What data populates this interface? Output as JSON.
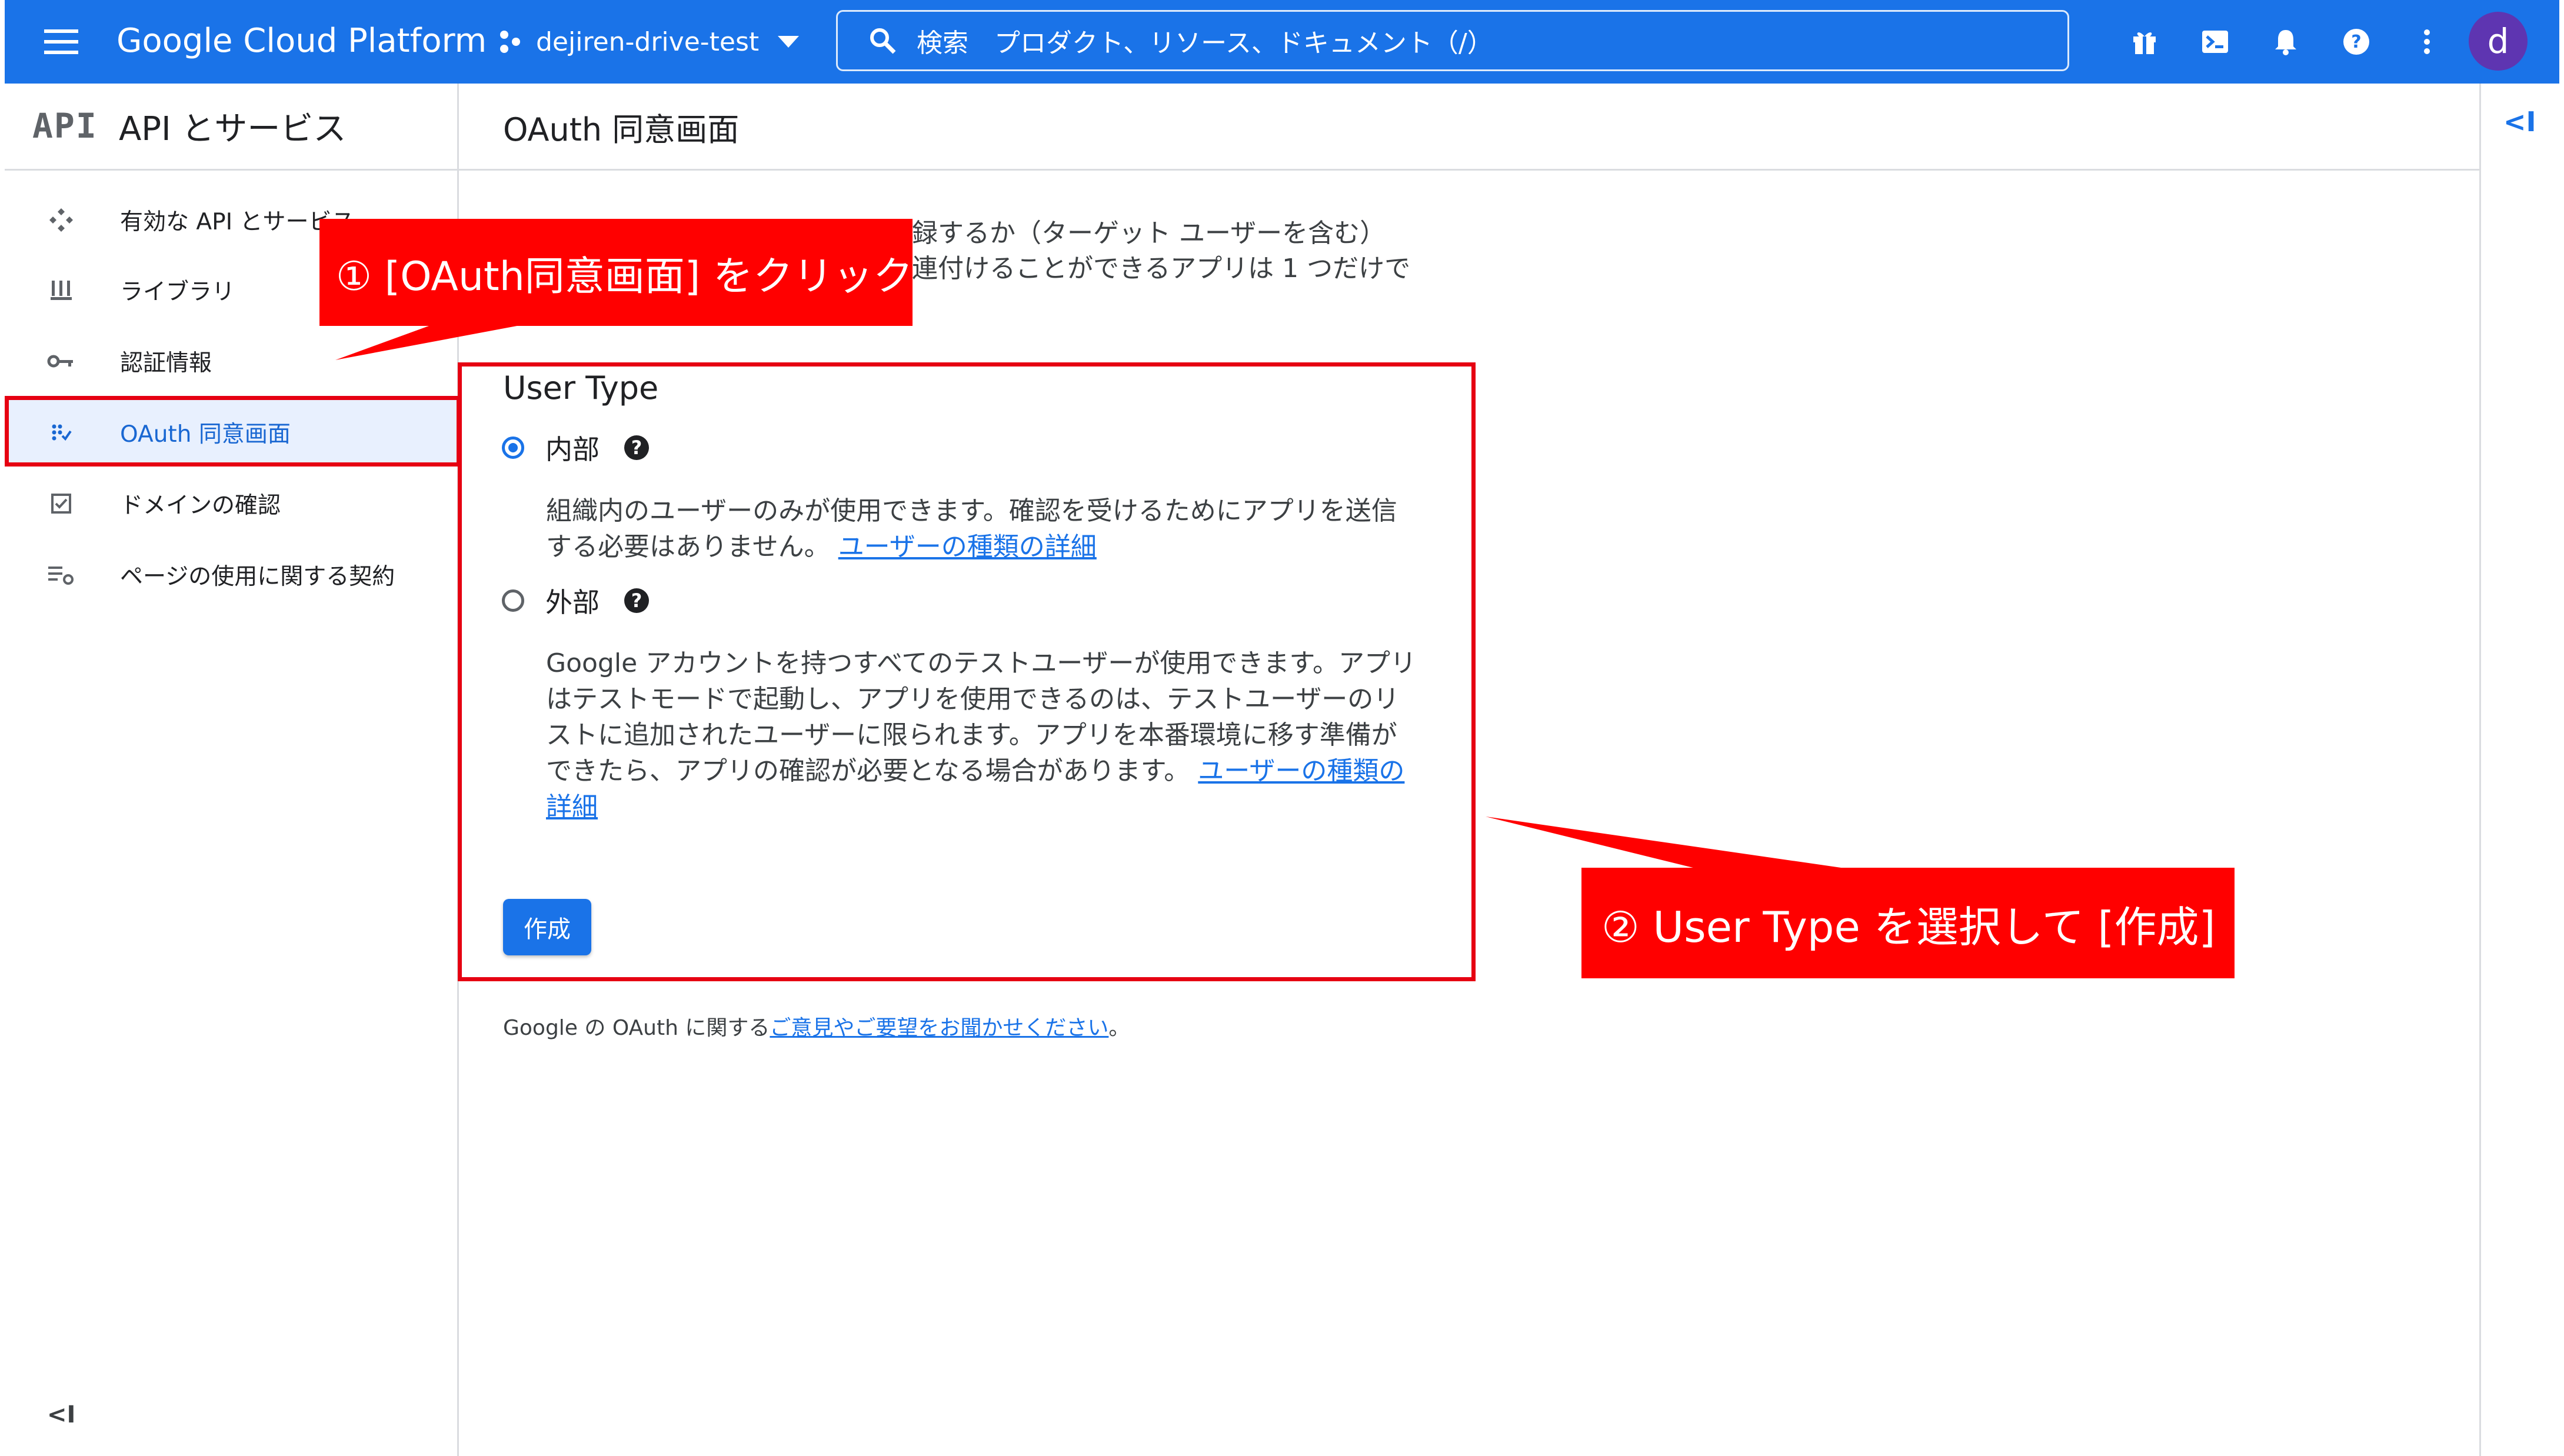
{
  "topbar": {
    "product_title": "Google Cloud Platform",
    "project_name": "dejiren-drive-test",
    "search_placeholder": "検索　プロダクト、リソース、ドキュメント（/）",
    "avatar_letter": "d",
    "icons": [
      "menu-icon",
      "gift-icon",
      "cloud-shell-icon",
      "notifications-icon",
      "help-icon",
      "more-vert-icon"
    ]
  },
  "sidebar": {
    "logo": "API",
    "title": "API とサービス",
    "items": [
      {
        "label": "有効な API とサービス",
        "icon": "api-icon"
      },
      {
        "label": "ライブラリ",
        "icon": "library-icon"
      },
      {
        "label": "認証情報",
        "icon": "key-icon"
      },
      {
        "label": "OAuth 同意画面",
        "icon": "oauth-consent-icon",
        "active": true
      },
      {
        "label": "ドメインの確認",
        "icon": "checkbox-icon"
      },
      {
        "label": "ページの使用に関する契約",
        "icon": "settings-list-icon"
      }
    ],
    "collapse_label": "<I"
  },
  "main": {
    "page_title": "OAuth 同意画面",
    "intro_line1": "録するか（ターゲット ユーザーを含む）",
    "intro_line2": "連付けることができるアプリは 1 つだけで",
    "user_type_title": "User Type",
    "options": [
      {
        "label": "内部",
        "selected": true,
        "description": "組織内のユーザーのみが使用できます。確認を受けるためにアプリを送信する必要はありません。",
        "link": "ユーザーの種類の詳細"
      },
      {
        "label": "外部",
        "selected": false,
        "description": "Google アカウントを持つすべてのテストユーザーが使用できます。アプリはテストモードで起動し、アプリを使用できるのは、テストユーザーのリストに追加されたユーザーに限られます。アプリを本番環境に移す準備ができたら、アプリの確認が必要となる場合があります。",
        "link": "ユーザーの種類の詳細"
      }
    ],
    "help_symbol": "?",
    "create_button": "作成",
    "footer_prefix": "Google の OAuth に関する",
    "footer_link": "ご意見やご要望をお聞かせください",
    "footer_suffix": "。",
    "collapse_right": "<I"
  },
  "annotations": {
    "callout1": "① [OAuth同意画面] をクリック",
    "callout2": "② User Type を選択して [作成]",
    "color": "#ff0000"
  },
  "colors": {
    "brand": "#1a73e8",
    "active_nav_bg": "#e8f0fe"
  }
}
